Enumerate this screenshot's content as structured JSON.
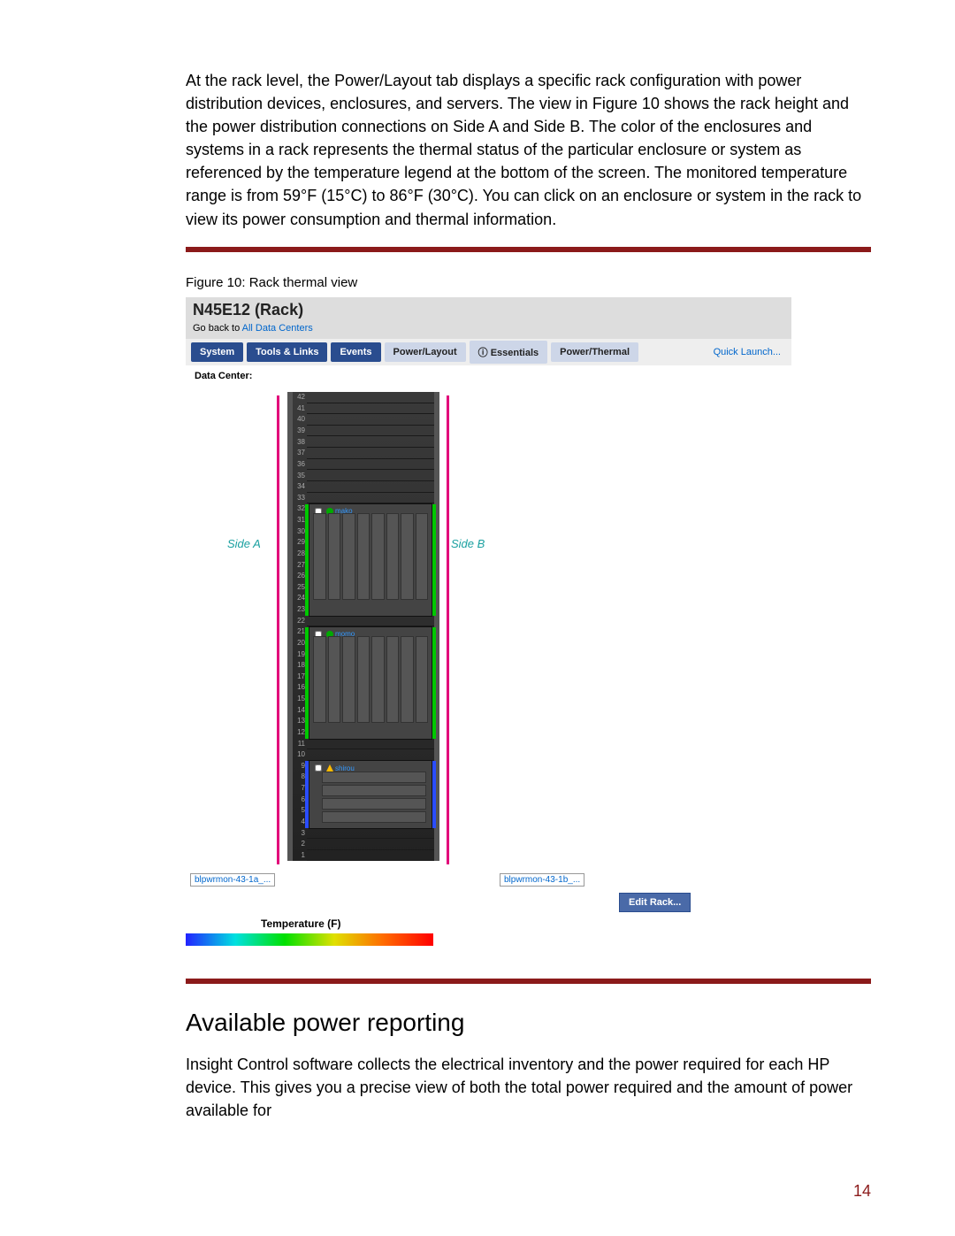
{
  "page_number": "14",
  "body_paragraph_1": "At the rack level, the Power/Layout tab displays a specific rack configuration with power distribution devices, enclosures, and servers. The view in Figure 10 shows the rack height and the power distribution connections on Side A and Side B. The color of the enclosures and systems in a rack represents the thermal status of the particular enclosure or system as referenced by the temperature legend at the bottom of the screen. The monitored temperature range is from 59°F (15°C) to 86°F (30°C). You can click on an enclosure or system in the rack to view its power consumption and thermal information.",
  "figure_caption": "Figure 10: Rack thermal view",
  "heading_2": "Available power reporting",
  "body_paragraph_2": "Insight Control software collects the electrical inventory and the power required for each HP device. This gives you a precise view of both the total power required and the amount of power available for",
  "fig": {
    "title": "N45E12 (Rack)",
    "back_link_prefix": "Go back to ",
    "back_link": "All Data Centers",
    "tabs": {
      "system": "System",
      "tools": "Tools & Links",
      "events": "Events",
      "power_layout": "Power/Layout",
      "essentials": "Essentials",
      "power_thermal": "Power/Thermal"
    },
    "quick_launch": "Quick Launch...",
    "data_center_label": "Data Center:",
    "side_a": "Side A",
    "side_b": "Side B",
    "rack_u_count": 42,
    "enclosures": [
      {
        "name": "mako",
        "top_u": 32,
        "bottom_u": 23,
        "status": "ok",
        "thermal": "#00c800"
      },
      {
        "name": "momo",
        "top_u": 21,
        "bottom_u": 12,
        "status": "ok",
        "thermal": "#00c800"
      },
      {
        "name": "shirou",
        "top_u": 9,
        "bottom_u": 4,
        "status": "warn",
        "thermal": "#2a4dff",
        "kind": "storage"
      }
    ],
    "pdu_a": "blpwrmon-43-1a_...",
    "pdu_b": "blpwrmon-43-1b_...",
    "edit_rack": "Edit Rack...",
    "temperature_label": "Temperature (F)"
  }
}
